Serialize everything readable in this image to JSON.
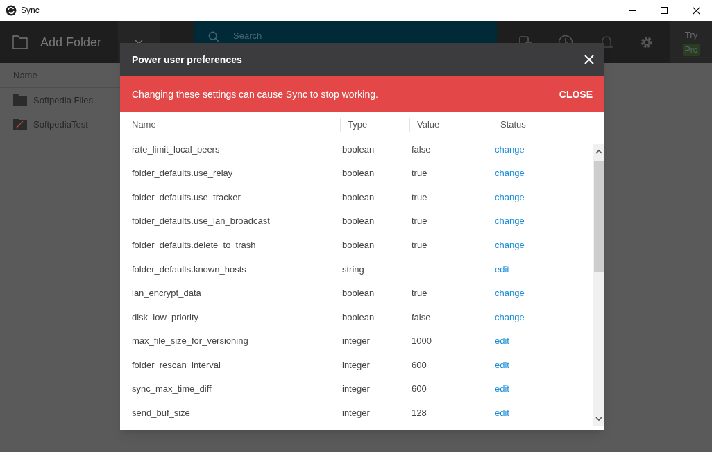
{
  "window": {
    "title": "Sync"
  },
  "toolbar": {
    "add_folder": "Add Folder",
    "search": {
      "placeholder": "Search"
    },
    "try_label": "Try",
    "pro_badge": "Pro"
  },
  "folder_list": {
    "column": "Name",
    "items": [
      {
        "name": "Softpedia Files",
        "kind": "folder"
      },
      {
        "name": "SoftpediaTest",
        "kind": "broken"
      }
    ]
  },
  "dialog": {
    "title": "Power user preferences",
    "warning": "Changing these settings can cause Sync to stop working.",
    "warning_action": "CLOSE",
    "columns": [
      "Name",
      "Type",
      "Value",
      "Status"
    ],
    "rows": [
      {
        "name": "rate_limit_local_peers",
        "type": "boolean",
        "value": "false",
        "status": "change"
      },
      {
        "name": "folder_defaults.use_relay",
        "type": "boolean",
        "value": "true",
        "status": "change"
      },
      {
        "name": "folder_defaults.use_tracker",
        "type": "boolean",
        "value": "true",
        "status": "change"
      },
      {
        "name": "folder_defaults.use_lan_broadcast",
        "type": "boolean",
        "value": "true",
        "status": "change"
      },
      {
        "name": "folder_defaults.delete_to_trash",
        "type": "boolean",
        "value": "true",
        "status": "change"
      },
      {
        "name": "folder_defaults.known_hosts",
        "type": "string",
        "status": "edit"
      },
      {
        "name": "lan_encrypt_data",
        "type": "boolean",
        "value": "true",
        "status": "change"
      },
      {
        "name": "disk_low_priority",
        "type": "boolean",
        "value": "false",
        "status": "change"
      },
      {
        "name": "max_file_size_for_versioning",
        "type": "integer",
        "value": "1000",
        "status": "edit"
      },
      {
        "name": "folder_rescan_interval",
        "type": "integer",
        "value": "600",
        "status": "edit"
      },
      {
        "name": "sync_max_time_diff",
        "type": "integer",
        "value": "600",
        "status": "edit"
      },
      {
        "name": "send_buf_size",
        "type": "integer",
        "value": "128",
        "status": "edit"
      }
    ]
  }
}
